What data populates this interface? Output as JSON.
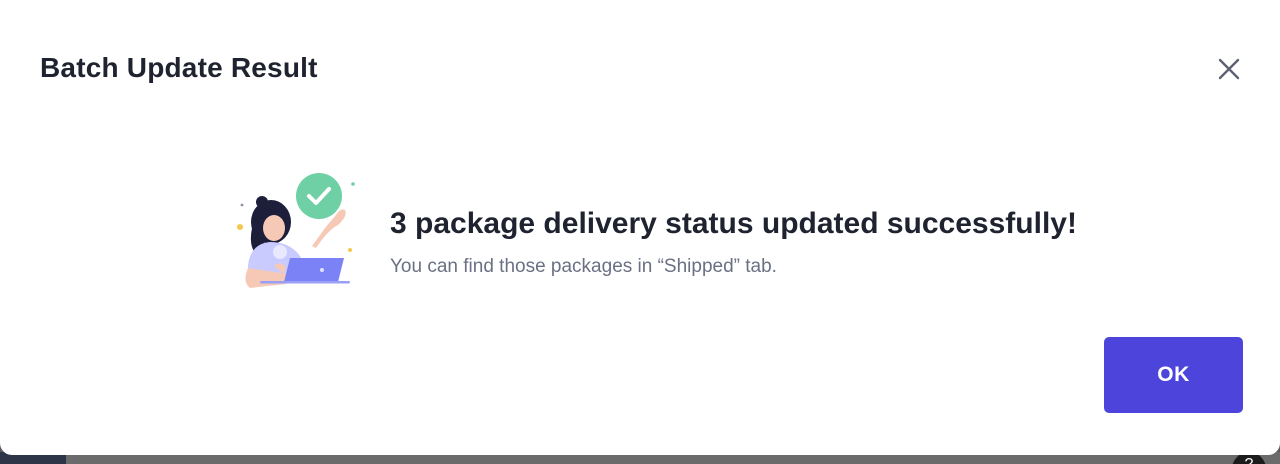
{
  "dialog": {
    "title": "Batch Update Result",
    "close_icon": "close-icon",
    "message_title": "3 package delivery status updated successfully!",
    "message_subtitle": "You can find those packages in “Shipped” tab.",
    "ok_label": "OK",
    "illustration": "success-person-laptop-illustration",
    "success_icon": "check-circle-icon"
  },
  "colors": {
    "primary": "#4d45db",
    "success": "#6fd0a5",
    "title_text": "#1f2330",
    "subtitle_text": "#6b7083",
    "close_icon": "#5d6272"
  }
}
